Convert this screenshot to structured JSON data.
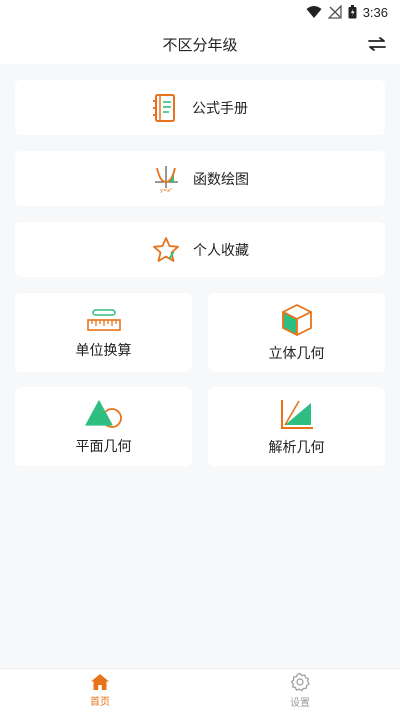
{
  "status_bar": {
    "time": "3:36",
    "icons": [
      "wifi-icon",
      "no-signal-icon",
      "battery-icon"
    ]
  },
  "header": {
    "title": "不区分年级",
    "action_icon": "swap-icon"
  },
  "menu": {
    "formula_handbook": "公式手册",
    "function_plot": "函数绘图",
    "favorites": "个人收藏",
    "unit_conversion": "单位换算",
    "solid_geometry": "立体几何",
    "plane_geometry": "平面几何",
    "analytic_geometry": "解析几何"
  },
  "tabs": {
    "home": "首页",
    "settings": "设置"
  },
  "colors": {
    "accent_orange": "#e8731a",
    "accent_green": "#2fbe82",
    "inactive_gray": "#9a9a9a",
    "background": "#f7f8fa"
  }
}
